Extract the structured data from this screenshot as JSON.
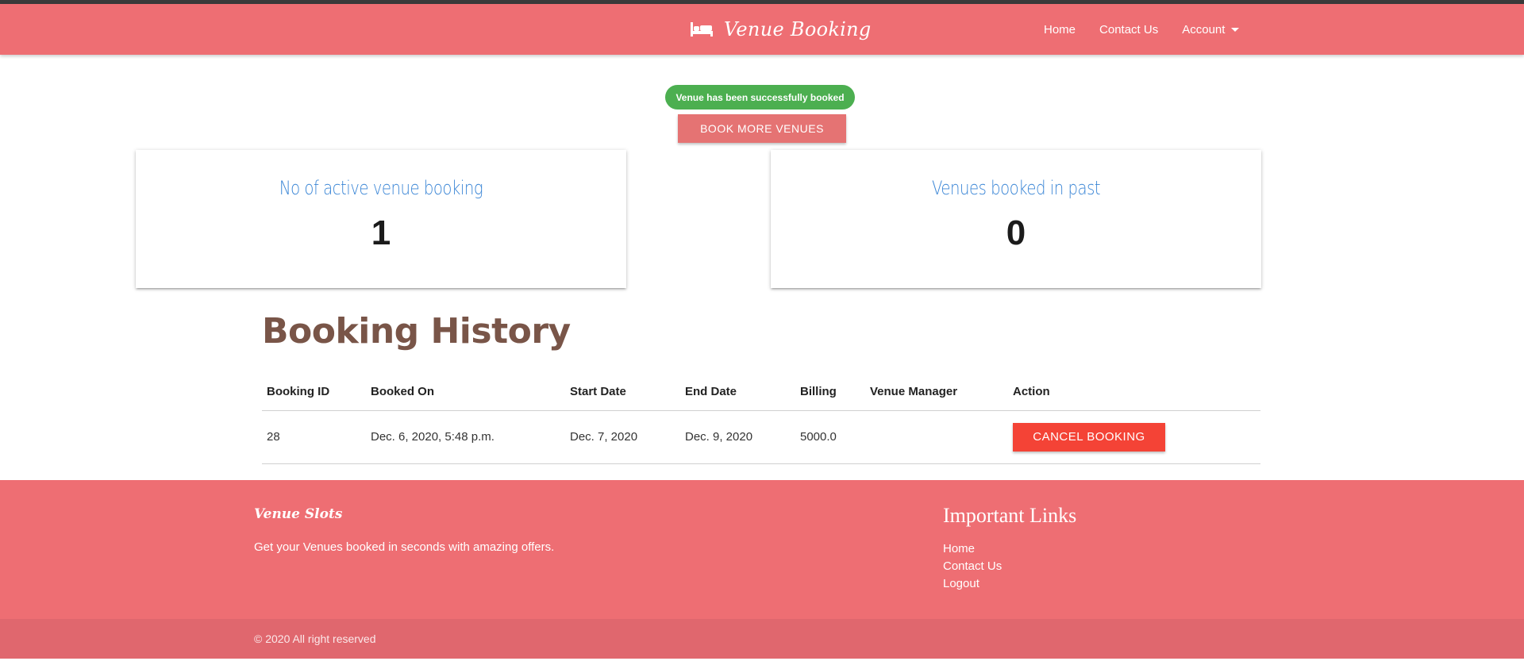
{
  "navbar": {
    "brand": "Venue Booking",
    "links": [
      {
        "label": "Home"
      },
      {
        "label": "Contact Us"
      },
      {
        "label": "Account"
      }
    ]
  },
  "alert": {
    "message": "Venue has been successfully booked"
  },
  "actions": {
    "book_more_label": "BOOK MORE VENUES"
  },
  "stats": {
    "active": {
      "title": "No of active venue booking",
      "value": "1"
    },
    "past": {
      "title": "Venues booked in past",
      "value": "0"
    }
  },
  "history": {
    "title": "Booking History",
    "columns": [
      "Booking ID",
      "Booked On",
      "Start Date",
      "End Date",
      "Billing",
      "Venue Manager",
      "Action"
    ],
    "rows": [
      {
        "booking_id": "28",
        "booked_on": "Dec. 6, 2020, 5:48 p.m.",
        "start_date": "Dec. 7, 2020",
        "end_date": "Dec. 9, 2020",
        "billing": "5000.0",
        "venue_manager": "",
        "action_label": "CANCEL BOOKING"
      }
    ]
  },
  "footer": {
    "brand": "Venue Slots",
    "tagline": "Get your Venues booked in seconds with amazing offers.",
    "links_title": "Important Links",
    "links": [
      "Home",
      "Contact Us",
      "Logout"
    ],
    "copyright": "© 2020 All right reserved"
  },
  "colors": {
    "primary": "#ee6e73",
    "success": "#4caf50",
    "danger": "#f44336",
    "book_more": "#e57373",
    "heading_brown": "#795548",
    "stat_title_blue": "#3b86d6"
  },
  "icons": {
    "brand": "bed-icon",
    "account_dropdown": "caret-down-icon"
  }
}
